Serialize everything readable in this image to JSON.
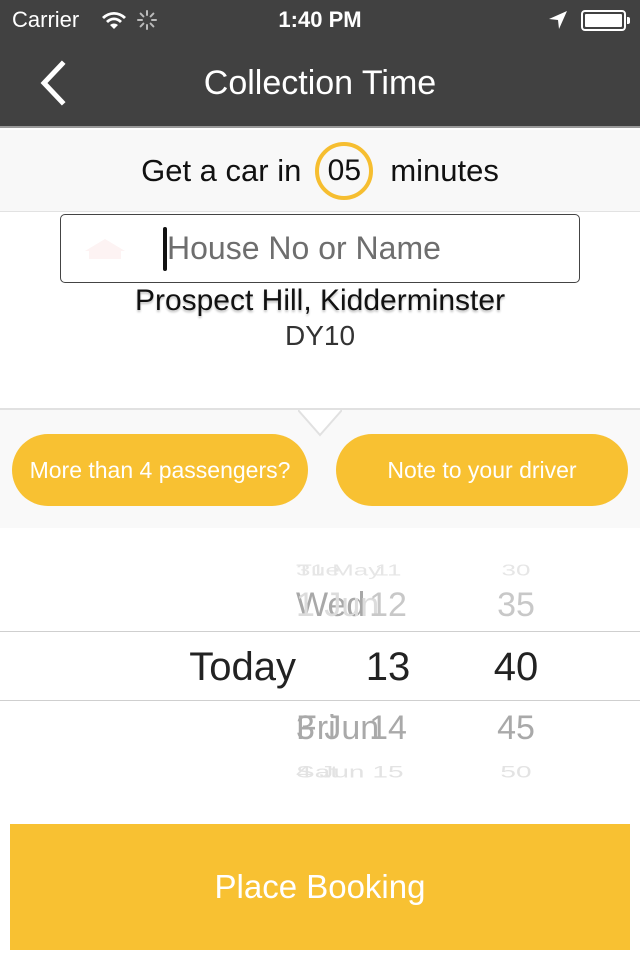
{
  "status_bar": {
    "carrier": "Carrier",
    "time": "1:40 PM",
    "icons": [
      "wifi-icon",
      "activity-spinner-icon",
      "location-arrow-icon",
      "battery-icon"
    ]
  },
  "nav": {
    "back_icon": "chevron-left-icon",
    "title": "Collection Time"
  },
  "eta": {
    "prefix": "Get a car in",
    "minutes": "05",
    "suffix": "minutes"
  },
  "address": {
    "house_input": {
      "value": "",
      "placeholder": "House No or Name",
      "icon": "house-icon"
    },
    "street": "Prospect Hill, Kidderminster",
    "postcode": "DY10"
  },
  "options": {
    "passengers_label": "More than 4 passengers?",
    "note_label": "Note to your driver"
  },
  "picker": {
    "rows": [
      {
        "date_a": "Tue",
        "date_b": "31 May",
        "hour": "11",
        "minute": "30"
      },
      {
        "date_a": "Wed",
        "date_b": "1 Jun",
        "hour": "12",
        "minute": "35"
      },
      {
        "date_a": "Today",
        "date_b": "",
        "hour": "13",
        "minute": "40"
      },
      {
        "date_a": "Fri",
        "date_b": "3 Jun",
        "hour": "14",
        "minute": "45"
      },
      {
        "date_a": "Sat",
        "date_b": "4 Jun",
        "hour": "15",
        "minute": "50"
      }
    ],
    "selected": {
      "date": "Today",
      "hour": "13",
      "minute": "40"
    }
  },
  "booking": {
    "button_label": "Place Booking"
  },
  "colors": {
    "accent": "#f8c132",
    "header_bg": "#414141",
    "banner_bg": "#f8f8f8"
  }
}
